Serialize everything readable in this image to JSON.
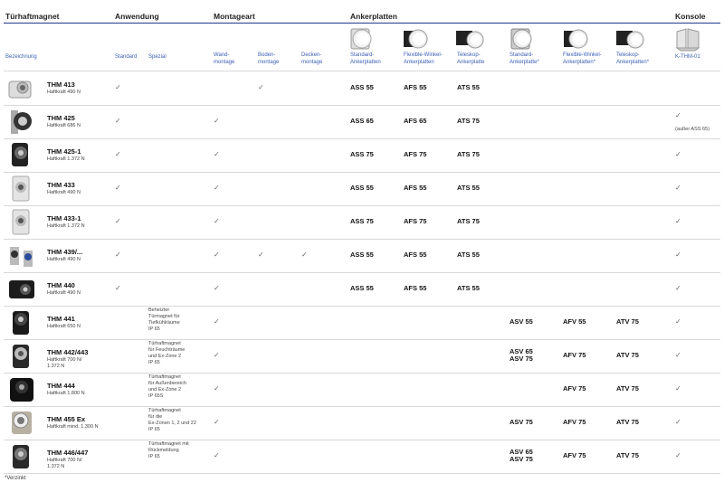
{
  "groups": {
    "tuerhaftmagnet": "Türhaftmagnet",
    "anwendung": "Anwendung",
    "montageart": "Montageart",
    "ankerplatten": "Ankerplatten",
    "konsole": "Konsole"
  },
  "subheaders": {
    "bezeichnung": "Bezeichnung",
    "standard": "Standard",
    "spezial": "Spezial",
    "wand": "Wand-\nmontage",
    "boden": "Boden-\nmontage",
    "decken": "Decken-\nmontage",
    "std_anker": "Standard-\nAnkerplatten",
    "flex_anker": "Flexible-Winkel-\nAnkerplatten",
    "tele_anker": "Teleskop-\nAnkerplatte",
    "std_anker2": "Standard-\nAnkerplatte*",
    "flex_anker2": "Flexible-Winkel-\nAnkerplatten*",
    "tele_anker2": "Teleskop-\nAnkerplatten*",
    "konsole": "K-THM-01"
  },
  "check": "✓",
  "rows": [
    {
      "name": "THM 413",
      "force": "Haftkraft 490 N",
      "std": true,
      "wand": false,
      "boden": true,
      "decken": false,
      "p1": "ASS 55",
      "p2": "AFS 55",
      "p3": "ATS 55",
      "p4": "",
      "p5": "",
      "p6": "",
      "kon": false,
      "kon_note": "",
      "spec": ""
    },
    {
      "name": "THM 425",
      "force": "Haftkraft 686 N",
      "std": true,
      "wand": true,
      "boden": false,
      "decken": false,
      "p1": "ASS 65",
      "p2": "AFS 65",
      "p3": "ATS 75",
      "p4": "",
      "p5": "",
      "p6": "",
      "kon": true,
      "kon_note": "(außer ASS 65)",
      "spec": ""
    },
    {
      "name": "THM 425-1",
      "force": "Haftkraft 1.372 N",
      "std": true,
      "wand": true,
      "boden": false,
      "decken": false,
      "p1": "ASS 75",
      "p2": "AFS 75",
      "p3": "ATS 75",
      "p4": "",
      "p5": "",
      "p6": "",
      "kon": true,
      "kon_note": "",
      "spec": ""
    },
    {
      "name": "THM 433",
      "force": "Haftkraft 490 N",
      "std": true,
      "wand": true,
      "boden": false,
      "decken": false,
      "p1": "ASS 55",
      "p2": "AFS 55",
      "p3": "ATS 55",
      "p4": "",
      "p5": "",
      "p6": "",
      "kon": true,
      "kon_note": "",
      "spec": ""
    },
    {
      "name": "THM 433-1",
      "force": "Haftkraft 1.372 N",
      "std": true,
      "wand": true,
      "boden": false,
      "decken": false,
      "p1": "ASS 75",
      "p2": "AFS 75",
      "p3": "ATS 75",
      "p4": "",
      "p5": "",
      "p6": "",
      "kon": true,
      "kon_note": "",
      "spec": ""
    },
    {
      "name": "THM 439/...",
      "force": "Haftkraft 490 N",
      "std": true,
      "wand": true,
      "boden": true,
      "decken": true,
      "p1": "ASS 55",
      "p2": "AFS 55",
      "p3": "ATS 55",
      "p4": "",
      "p5": "",
      "p6": "",
      "kon": true,
      "kon_note": "",
      "spec": ""
    },
    {
      "name": "THM 440",
      "force": "Haftkraft 490 N",
      "std": true,
      "wand": true,
      "boden": false,
      "decken": false,
      "p1": "ASS 55",
      "p2": "AFS 55",
      "p3": "ATS 55",
      "p4": "",
      "p5": "",
      "p6": "",
      "kon": true,
      "kon_note": "",
      "spec": ""
    },
    {
      "name": "THM 441",
      "force": "Haftkraft 650 N",
      "std": false,
      "wand": true,
      "boden": false,
      "decken": false,
      "p1": "",
      "p2": "",
      "p3": "",
      "p4": "ASV 55",
      "p5": "AFV 55",
      "p6": "ATV 75",
      "kon": true,
      "kon_note": "",
      "spec": "Beheizter\nTürmagnet für\nTiefkühlräume\nIP 65"
    },
    {
      "name": "THM 442/443",
      "force": "Haftkraft 700 N/\n1.372 N",
      "std": false,
      "wand": true,
      "boden": false,
      "decken": false,
      "p1": "",
      "p2": "",
      "p3": "",
      "p4": "ASV 65\nASV 75",
      "p5": "AFV 75",
      "p6": "ATV 75",
      "kon": true,
      "kon_note": "",
      "spec": "Türhaftmagnet\nfür Feuchträume\nund Ex-Zone 2\nIP 65"
    },
    {
      "name": "THM 444",
      "force": "Haftkraft 1.800 N",
      "std": false,
      "wand": true,
      "boden": false,
      "decken": false,
      "p1": "",
      "p2": "",
      "p3": "",
      "p4": "",
      "p5": "AFV 75",
      "p6": "ATV 75",
      "kon": true,
      "kon_note": "",
      "spec": "Türhaftmagnet\nfür Außenbereich\nund Ex-Zone 2\nIP 65S"
    },
    {
      "name": "THM 455 Ex",
      "force": "Haftkraft mind. 1.300 N",
      "std": false,
      "wand": true,
      "boden": false,
      "decken": false,
      "p1": "",
      "p2": "",
      "p3": "",
      "p4": "ASV 75",
      "p5": "AFV 75",
      "p6": "ATV 75",
      "kon": true,
      "kon_note": "",
      "spec": "Türhaftmagnet\nfür die\nEx-Zonen 1, 2 und 22\nIP 65"
    },
    {
      "name": "THM 446/447",
      "force": "Haftkraft 700 N/\n1.372 N",
      "std": false,
      "wand": true,
      "boden": false,
      "decken": false,
      "p1": "",
      "p2": "",
      "p3": "",
      "p4": "ASV 65\nASV 75",
      "p5": "AFV 75",
      "p6": "ATV 75",
      "kon": true,
      "kon_note": "",
      "spec": "Türhaftmagnet mit\nRückmeldung\nIP 65"
    }
  ],
  "footnote": "*Verzinkt"
}
